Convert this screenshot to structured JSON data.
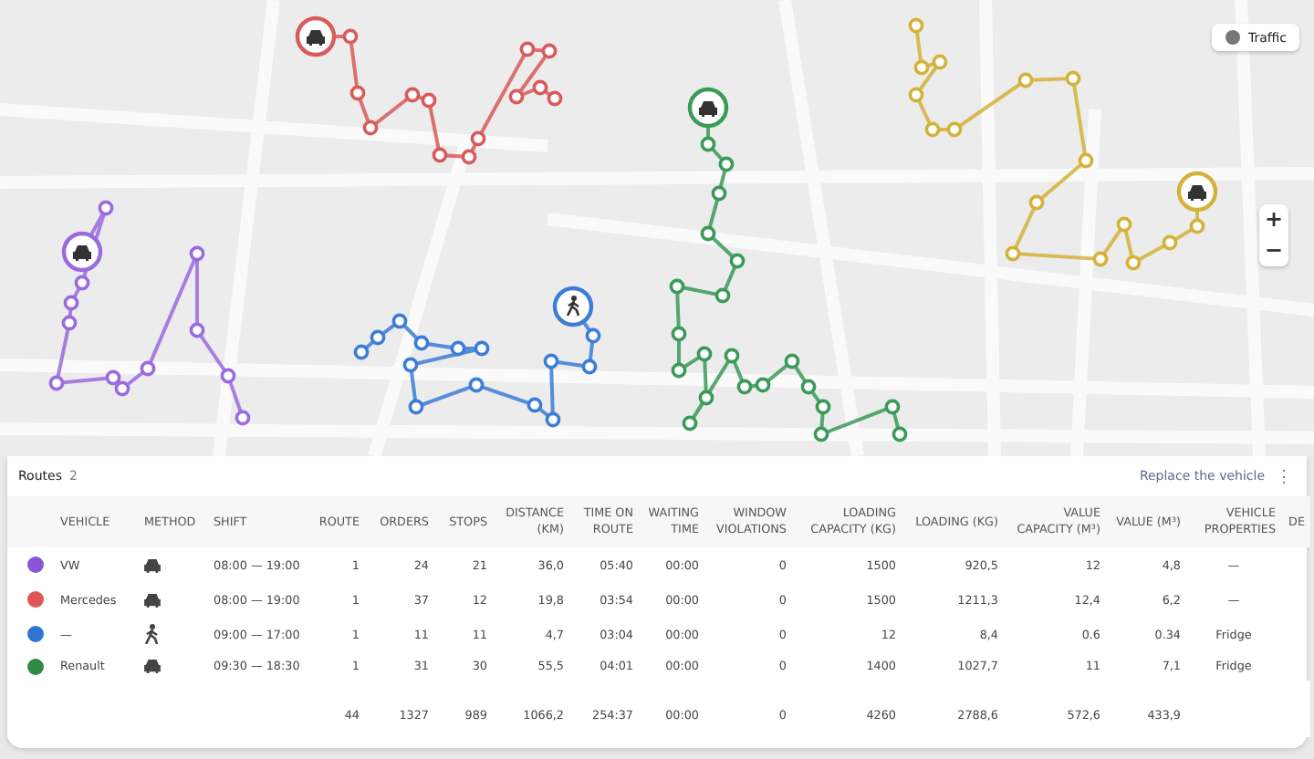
{
  "map": {
    "traffic_button": "Traffic",
    "zoom_in": "+",
    "zoom_out": "−"
  },
  "routes_panel": {
    "title": "Routes",
    "count": "2",
    "replace_link": "Replace the vehicle",
    "more_menu": "⋮"
  },
  "table": {
    "columns": [
      "VEHICLE",
      "METHOD",
      "SHIFT",
      "ROUTE",
      "ORDERS",
      "STOPS",
      "DISTANCE (KM)",
      "TIME ON ROUTE",
      "WAITING TIME",
      "WINDOW VIOLATIONS",
      "LOADING CAPACITY (KG)",
      "LOADING (KG)",
      "VALUE CAPACITY (M³)",
      "VALUE (M³)",
      "VEHICLE PROPERTIES",
      "DE"
    ],
    "rows": [
      {
        "color": "#8b55d9",
        "vehicle": "VW",
        "kind": "car",
        "shift": "08:00 — 19:00",
        "values": [
          "1",
          "24",
          "21",
          "36,0",
          "05:40",
          "00:00",
          "0",
          "1500",
          "920,5",
          "12",
          "4,8",
          "—"
        ]
      },
      {
        "color": "#e05555",
        "vehicle": "Mercedes",
        "kind": "car",
        "shift": "08:00 — 19:00",
        "values": [
          "1",
          "37",
          "12",
          "19,8",
          "03:54",
          "00:00",
          "0",
          "1500",
          "1211,3",
          "12,4",
          "6,2",
          "—"
        ]
      },
      {
        "color": "#2f74d0",
        "vehicle": "—",
        "kind": "walk",
        "shift": "09:00 — 17:00",
        "values": [
          "1",
          "11",
          "11",
          "4,7",
          "03:04",
          "00:00",
          "0",
          "12",
          "8,4",
          "0.6",
          "0.34",
          "Fridge"
        ]
      },
      {
        "color": "#2e8b45",
        "vehicle": "Renault",
        "kind": "car",
        "shift": "09:30 — 18:30",
        "values": [
          "1",
          "31",
          "30",
          "55,5",
          "04:01",
          "00:00",
          "0",
          "1400",
          "1027,7",
          "11",
          "7,1",
          "Fridge"
        ]
      }
    ],
    "totals": [
      "44",
      "1327",
      "989",
      "1066,2",
      "254:37",
      "00:00",
      "0",
      "4260",
      "2788,6",
      "572,6",
      "433,9"
    ]
  }
}
